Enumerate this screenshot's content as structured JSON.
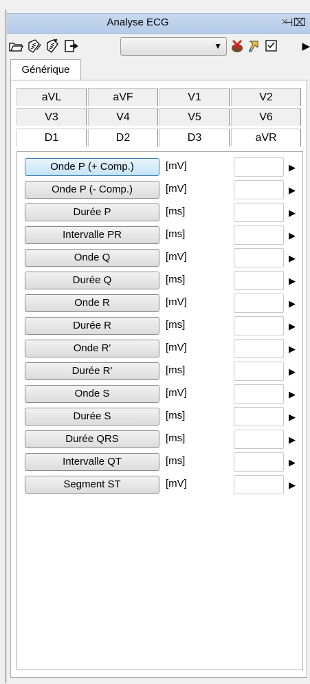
{
  "window": {
    "title": "Analyse ECG",
    "close_glyph": "×",
    "pin_glyph": "⊣⌧"
  },
  "toolbar": {
    "icons": [
      "open-folder-icon",
      "edit-sheet-icon",
      "paste-sheet-icon",
      "export-icon",
      "red-x-icon",
      "wand-icon",
      "checkbox-icon"
    ],
    "combo_value": "",
    "more_glyph": "▶"
  },
  "main_tab": {
    "label": "Générique"
  },
  "lead_tabs": {
    "row1": [
      "aVL",
      "aVF",
      "V1",
      "V2"
    ],
    "row2": [
      "V3",
      "V4",
      "V5",
      "V6"
    ],
    "row3": [
      "D1",
      "D2",
      "D3",
      "aVR"
    ]
  },
  "measurements": [
    {
      "label": "Onde P (+ Comp.)",
      "unit": "[mV]",
      "value": ""
    },
    {
      "label": "Onde P (- Comp.)",
      "unit": "[mV]",
      "value": ""
    },
    {
      "label": "Durée P",
      "unit": "[ms]",
      "value": ""
    },
    {
      "label": "Intervalle PR",
      "unit": "[ms]",
      "value": ""
    },
    {
      "label": "Onde Q",
      "unit": "[mV]",
      "value": ""
    },
    {
      "label": "Durée Q",
      "unit": "[ms]",
      "value": ""
    },
    {
      "label": "Onde R",
      "unit": "[mV]",
      "value": ""
    },
    {
      "label": "Durée R",
      "unit": "[ms]",
      "value": ""
    },
    {
      "label": "Onde R'",
      "unit": "[mV]",
      "value": ""
    },
    {
      "label": "Durée R'",
      "unit": "[ms]",
      "value": ""
    },
    {
      "label": "Onde S",
      "unit": "[mV]",
      "value": ""
    },
    {
      "label": "Durée S",
      "unit": "[ms]",
      "value": ""
    },
    {
      "label": "Durée QRS",
      "unit": "[ms]",
      "value": ""
    },
    {
      "label": "Intervalle QT",
      "unit": "[ms]",
      "value": ""
    },
    {
      "label": "Segment ST",
      "unit": "[mV]",
      "value": ""
    }
  ],
  "arrow_glyph": "▶"
}
